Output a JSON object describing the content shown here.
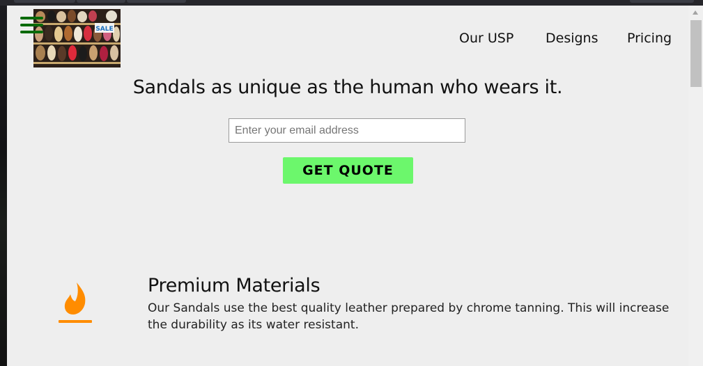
{
  "nav": {
    "items": [
      {
        "label": "Our USP"
      },
      {
        "label": "Designs"
      },
      {
        "label": "Pricing"
      }
    ]
  },
  "logo": {
    "sale_text": "SALE"
  },
  "hero": {
    "title": "Sandals as unique as the human who wears it.",
    "email_placeholder": "Enter your email address",
    "email_value": "",
    "cta_label": "GET QUOTE"
  },
  "features": [
    {
      "icon": "fire-icon",
      "title": "Premium Materials",
      "text": "Our Sandals use the best quality leather prepared by chrome tanning. This will increase the durability as its water resistant."
    }
  ],
  "colors": {
    "page_background": "#eeeeee",
    "cta_background": "#6cf76c",
    "hamburger": "#0a6a0a",
    "fire_icon": "#ff8c00"
  }
}
